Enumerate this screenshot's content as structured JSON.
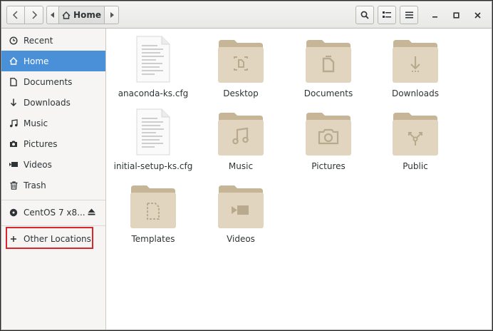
{
  "header": {
    "breadcrumb_label": "Home",
    "icons": {
      "back": "chevron-left-icon",
      "forward": "chevron-right-icon",
      "path_left": "triangle-left-icon",
      "path_right": "triangle-right-icon",
      "home": "home-icon",
      "search": "search-icon",
      "view_toggle": "list-view-icon",
      "menu": "hamburger-menu-icon",
      "minimize": "minimize-icon",
      "maximize": "maximize-icon",
      "close": "close-icon"
    }
  },
  "sidebar": {
    "items": [
      {
        "label": "Recent",
        "icon": "clock-icon",
        "active": false
      },
      {
        "label": "Home",
        "icon": "home-icon",
        "active": true
      },
      {
        "label": "Documents",
        "icon": "document-icon",
        "active": false
      },
      {
        "label": "Downloads",
        "icon": "download-icon",
        "active": false
      },
      {
        "label": "Music",
        "icon": "music-icon",
        "active": false
      },
      {
        "label": "Pictures",
        "icon": "camera-icon",
        "active": false
      },
      {
        "label": "Videos",
        "icon": "video-icon",
        "active": false
      },
      {
        "label": "Trash",
        "icon": "trash-icon",
        "active": false
      }
    ],
    "device": {
      "label": "CentOS 7 x8...",
      "icon": "disk-icon",
      "action_icon": "eject-icon"
    },
    "other_locations": {
      "label": "Other Locations",
      "icon": "plus-icon"
    }
  },
  "files": [
    {
      "name": "anaconda-ks.cfg",
      "type": "text-file",
      "emblem": "text-file-icon"
    },
    {
      "name": "Desktop",
      "type": "folder",
      "emblem": "desktop-folder-icon"
    },
    {
      "name": "Documents",
      "type": "folder",
      "emblem": "documents-folder-icon"
    },
    {
      "name": "Downloads",
      "type": "folder",
      "emblem": "downloads-folder-icon"
    },
    {
      "name": "initial-setup-ks.cfg",
      "type": "text-file",
      "emblem": "text-file-icon"
    },
    {
      "name": "Music",
      "type": "folder",
      "emblem": "music-folder-icon"
    },
    {
      "name": "Pictures",
      "type": "folder",
      "emblem": "pictures-folder-icon"
    },
    {
      "name": "Public",
      "type": "folder",
      "emblem": "public-folder-icon"
    },
    {
      "name": "Templates",
      "type": "folder",
      "emblem": "templates-folder-icon"
    },
    {
      "name": "Videos",
      "type": "folder",
      "emblem": "videos-folder-icon"
    }
  ],
  "colors": {
    "accent": "#4a90d9",
    "folder_tab": "#c6b596",
    "folder_body": "#e2d5bf",
    "folder_emblem": "#b9aa8f",
    "highlight": "#d9272e"
  }
}
